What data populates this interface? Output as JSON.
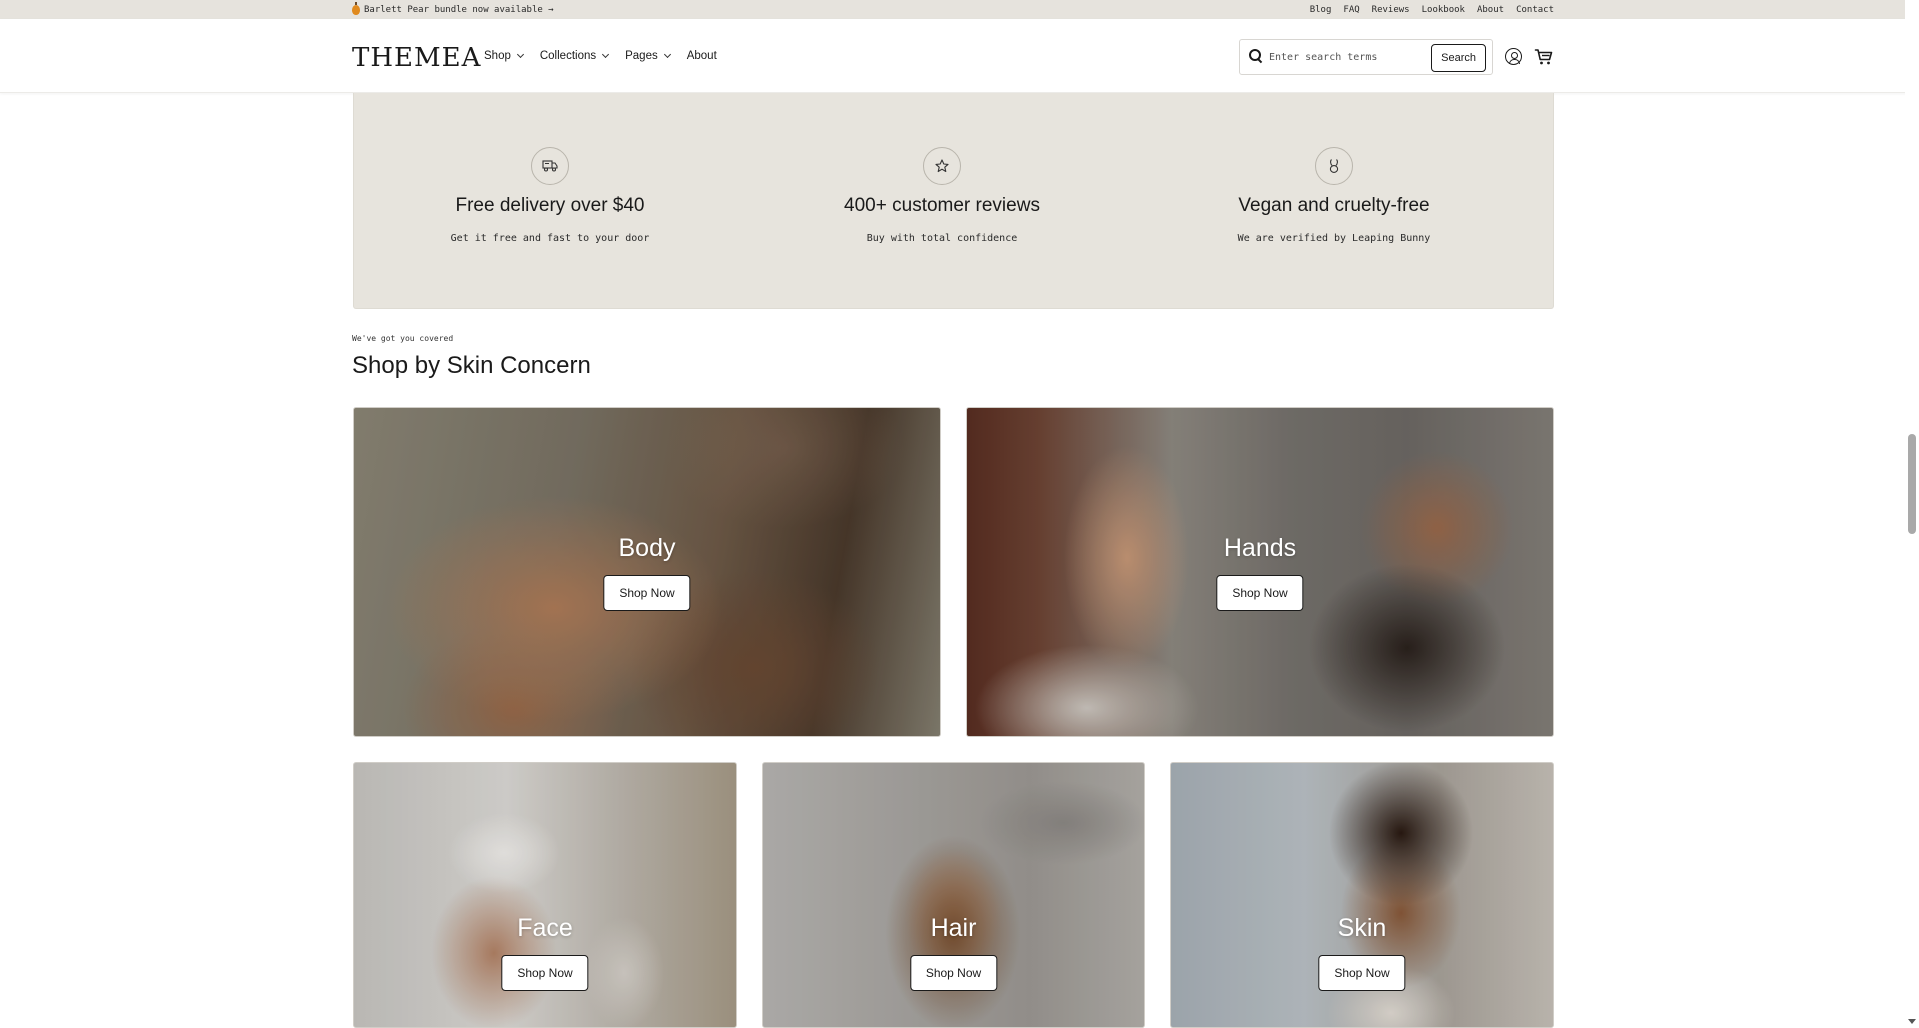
{
  "announcement": {
    "text": "Barlett Pear bundle now available →",
    "links": [
      "Blog",
      "FAQ",
      "Reviews",
      "Lookbook",
      "About",
      "Contact"
    ]
  },
  "header": {
    "logo": "THEMEA",
    "nav": [
      {
        "label": "Shop",
        "dropdown": true
      },
      {
        "label": "Collections",
        "dropdown": true
      },
      {
        "label": "Pages",
        "dropdown": true
      },
      {
        "label": "About",
        "dropdown": false
      }
    ],
    "search": {
      "placeholder": "Enter search terms",
      "value": "",
      "button_label": "Search"
    }
  },
  "features": [
    {
      "icon": "delivery-truck-icon",
      "title": "Free delivery over $40",
      "subtitle": "Get it free and fast to your door"
    },
    {
      "icon": "star-icon",
      "title": "400+ customer reviews",
      "subtitle": "Buy with total confidence"
    },
    {
      "icon": "bunny-icon",
      "title": "Vegan and cruelty-free",
      "subtitle": "We are verified by Leaping Bunny"
    }
  ],
  "section": {
    "eyebrow": "We've got you covered",
    "title": "Shop by Skin Concern"
  },
  "cards": [
    {
      "title": "Body",
      "button": "Shop Now"
    },
    {
      "title": "Hands",
      "button": "Shop Now"
    },
    {
      "title": "Face",
      "button": "Shop Now"
    },
    {
      "title": "Hair",
      "button": "Shop Now"
    },
    {
      "title": "Skin",
      "button": "Shop Now"
    }
  ],
  "colors": {
    "announcement_bg": "#e6e3dd",
    "feature_band_bg": "#e7e4dd",
    "text": "#1a1a1a"
  }
}
